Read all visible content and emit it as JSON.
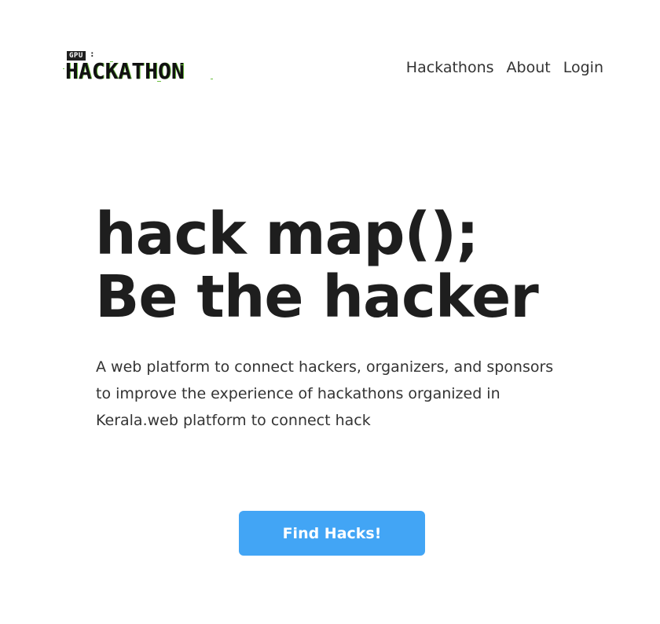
{
  "logo": {
    "badge": "GPU",
    "colon": ":",
    "word": "HACKATHON"
  },
  "nav": {
    "items": [
      "Hackathons",
      "About",
      "Login"
    ]
  },
  "hero": {
    "line1": "hack map();",
    "line2": "Be the hacker",
    "description": "A web platform to connect hackers, organizers, and sponsors to improve the experience of hackathons organized in Kerala.web platform to connect hack"
  },
  "cta": {
    "label": "Find Hacks!"
  },
  "colors": {
    "accent": "#42a5f5",
    "logo_glitch": "#6bbf3f"
  }
}
